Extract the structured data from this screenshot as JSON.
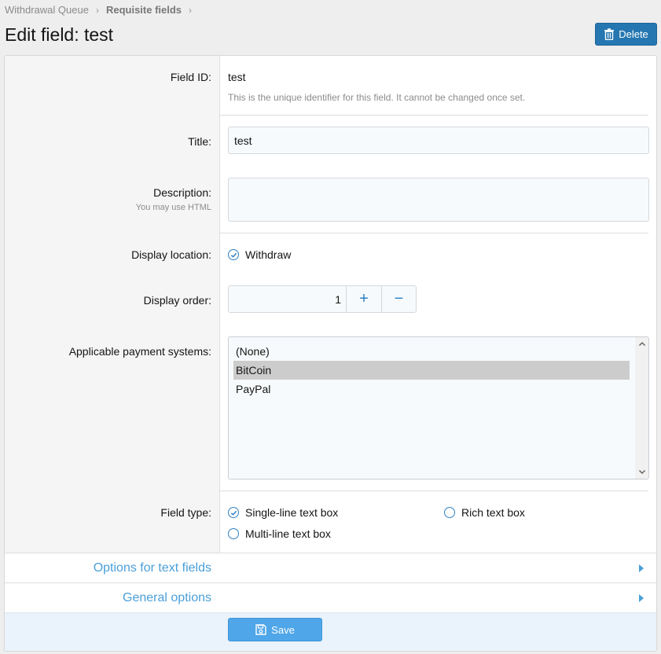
{
  "breadcrumb": {
    "items": [
      "Withdrawal Queue",
      "Requisite fields"
    ],
    "separator": "›"
  },
  "header": {
    "title": "Edit field: test",
    "delete_label": "Delete"
  },
  "form": {
    "field_id": {
      "label": "Field ID:",
      "value": "test",
      "explain": "This is the unique identifier for this field. It cannot be changed once set."
    },
    "title": {
      "label": "Title:",
      "value": "test"
    },
    "description": {
      "label": "Description:",
      "hint": "You may use HTML",
      "value": ""
    },
    "display_location": {
      "label": "Display location:",
      "option": "Withdraw",
      "checked": true
    },
    "display_order": {
      "label": "Display order:",
      "value": "1",
      "plus": "+",
      "minus": "−"
    },
    "payment_systems": {
      "label": "Applicable payment systems:",
      "options": [
        "(None)",
        "BitCoin",
        "PayPal"
      ],
      "selected": "BitCoin"
    },
    "field_type": {
      "label": "Field type:",
      "options": [
        "Single-line text box",
        "Rich text box",
        "Multi-line text box"
      ],
      "selected": "Single-line text box"
    }
  },
  "sections": {
    "text_options": "Options for text fields",
    "general_options": "General options"
  },
  "footer": {
    "save_label": "Save"
  },
  "colors": {
    "accent": "#2577b1",
    "link": "#4a9fd8",
    "save": "#4fa6e8",
    "footer_bg": "#eaf3fb"
  }
}
